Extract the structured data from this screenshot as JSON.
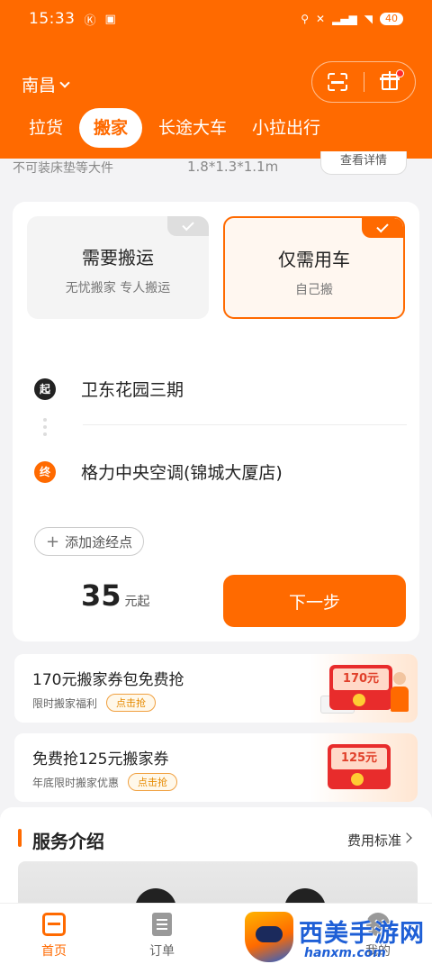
{
  "status_bar": {
    "time": "15:33",
    "battery": "40"
  },
  "header": {
    "city": "南昌",
    "tabs": [
      "拉货",
      "搬家",
      "长途大车",
      "小拉出行"
    ],
    "active_tab": "搬家"
  },
  "remnant_row": {
    "left": "不可装床垫等大件",
    "middle": "1.8*1.3*1.1m",
    "right": "查看详情"
  },
  "mode": {
    "option_a": {
      "title": "需要搬运",
      "subtitle": "无忧搬家 专人搬运"
    },
    "option_b": {
      "title": "仅需用车",
      "subtitle": "自己搬"
    },
    "selected": "仅需用车"
  },
  "route": {
    "start_badge": "起",
    "start": "卫东花园三期",
    "end_badge": "终",
    "end": "格力中央空调(锦城大厦店)",
    "add_stop": "添加途经点"
  },
  "price": {
    "amount": "35",
    "unit": "元起"
  },
  "next_button": "下一步",
  "promos": [
    {
      "title": "170元搬家券包免费抢",
      "subtitle": "限时搬家福利",
      "action": "点击抢",
      "coupon": "170元"
    },
    {
      "title": "免费抢125元搬家券",
      "subtitle": "年底限时搬家优惠",
      "action": "点击抢",
      "coupon": "125元"
    }
  ],
  "services": {
    "title": "服务介绍",
    "fee_link": "费用标准"
  },
  "bottom_nav": [
    {
      "label": "首页",
      "icon": "home-icon",
      "active": true
    },
    {
      "label": "订单",
      "icon": "order-icon",
      "active": false
    },
    {
      "label": "我的",
      "icon": "user-icon",
      "active": false
    }
  ],
  "watermark": {
    "title": "西美手游网",
    "url": "hanxm.com"
  },
  "colors": {
    "accent": "#ff6a00",
    "background": "#f3f3f5"
  }
}
